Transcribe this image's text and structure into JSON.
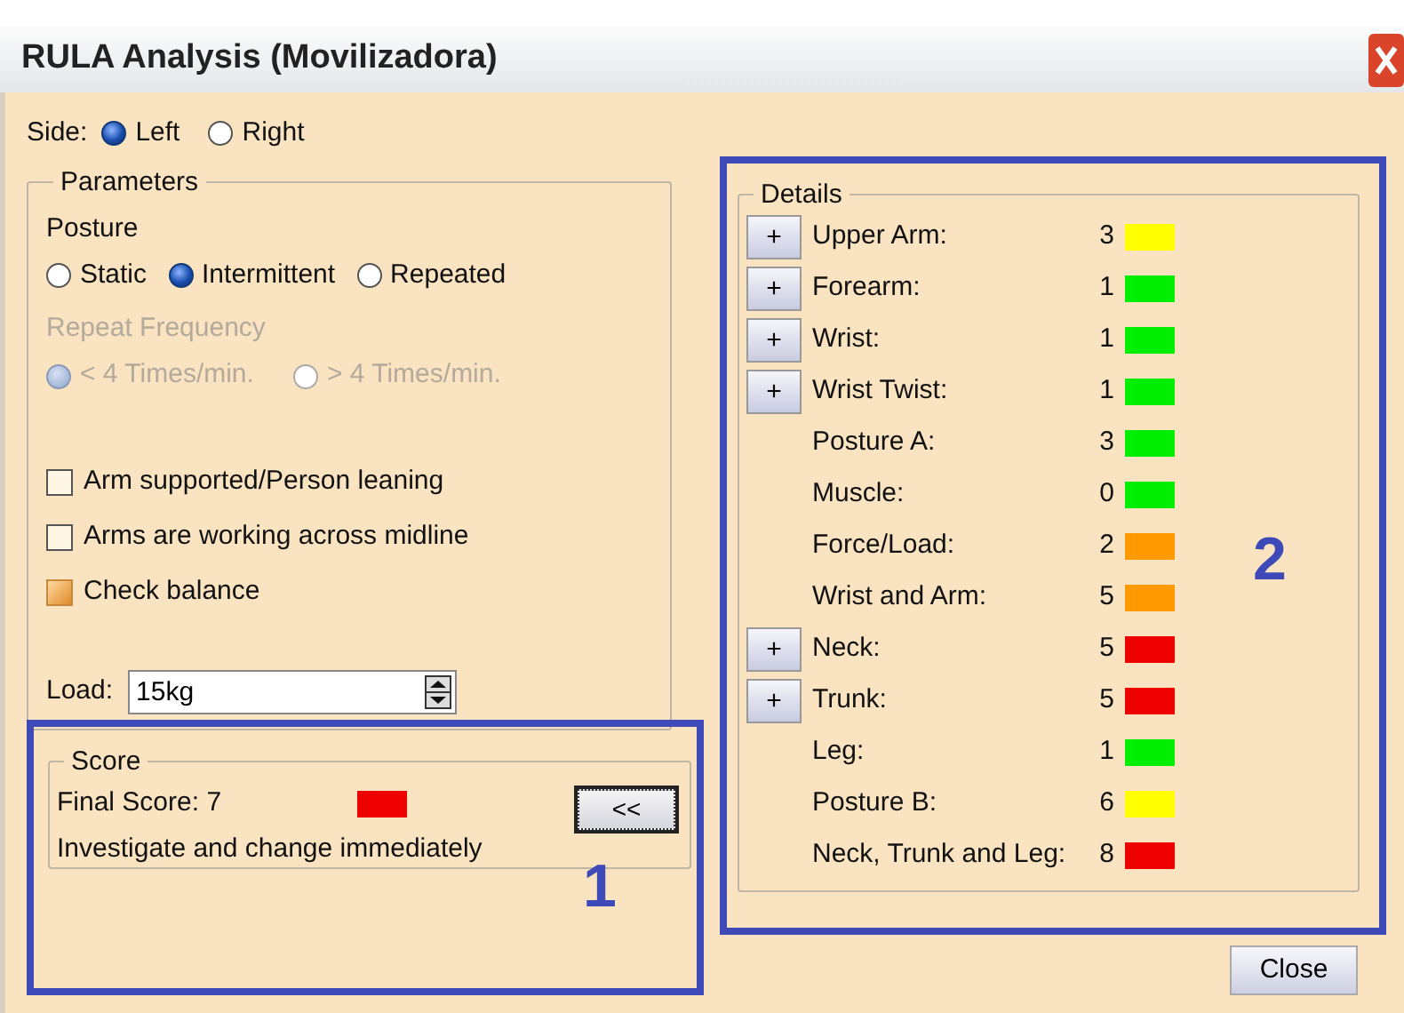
{
  "window": {
    "title": "RULA Analysis (Movilizadora)"
  },
  "side": {
    "label": "Side:",
    "options": [
      {
        "label": "Left",
        "selected": true
      },
      {
        "label": "Right",
        "selected": false
      }
    ]
  },
  "parameters": {
    "title": "Parameters",
    "posture": {
      "label": "Posture",
      "options": [
        {
          "label": "Static",
          "selected": false
        },
        {
          "label": "Intermittent",
          "selected": true
        },
        {
          "label": "Repeated",
          "selected": false
        }
      ]
    },
    "repeat_frequency": {
      "label": "Repeat Frequency",
      "disabled": true,
      "options": [
        {
          "label": "< 4 Times/min.",
          "selected": true
        },
        {
          "label": "> 4 Times/min.",
          "selected": false
        }
      ]
    },
    "checkboxes": [
      {
        "label": "Arm supported/Person leaning",
        "checked": false
      },
      {
        "label": "Arms are working across midline",
        "checked": false
      },
      {
        "label": "Check balance",
        "checked": true
      }
    ],
    "load": {
      "label": "Load:",
      "value": "15kg"
    }
  },
  "score": {
    "title": "Score",
    "final_score": "Final Score: 7",
    "color": "#ee0000",
    "message": "Investigate and change immediately",
    "collapse_button": "<<"
  },
  "details": {
    "title": "Details",
    "rows": [
      {
        "button": "+",
        "label": "Upper Arm:",
        "value": "3",
        "color": "#ffff00"
      },
      {
        "button": "+",
        "label": "Forearm:",
        "value": "1",
        "color": "#00ee00"
      },
      {
        "button": "+",
        "label": "Wrist:",
        "value": "1",
        "color": "#00ee00"
      },
      {
        "button": "+",
        "label": "Wrist Twist:",
        "value": "1",
        "color": "#00ee00"
      },
      {
        "label": "Posture A:",
        "value": "3",
        "color": "#00ee00"
      },
      {
        "label": "Muscle:",
        "value": "0",
        "color": "#00ee00"
      },
      {
        "label": "Force/Load:",
        "value": "2",
        "color": "#ff9900"
      },
      {
        "label": "Wrist and Arm:",
        "value": "5",
        "color": "#ff9900"
      },
      {
        "button": "+",
        "label": "Neck:",
        "value": "5",
        "color": "#ee0000"
      },
      {
        "button": "+",
        "label": "Trunk:",
        "value": "5",
        "color": "#ee0000"
      },
      {
        "label": "Leg:",
        "value": "1",
        "color": "#00ee00"
      },
      {
        "label": "Posture B:",
        "value": "6",
        "color": "#ffff00"
      },
      {
        "label": "Neck, Trunk and Leg:",
        "value": "8",
        "color": "#ee0000"
      }
    ]
  },
  "close_button": "Close",
  "annotations": [
    {
      "label": "1"
    },
    {
      "label": "2"
    }
  ]
}
